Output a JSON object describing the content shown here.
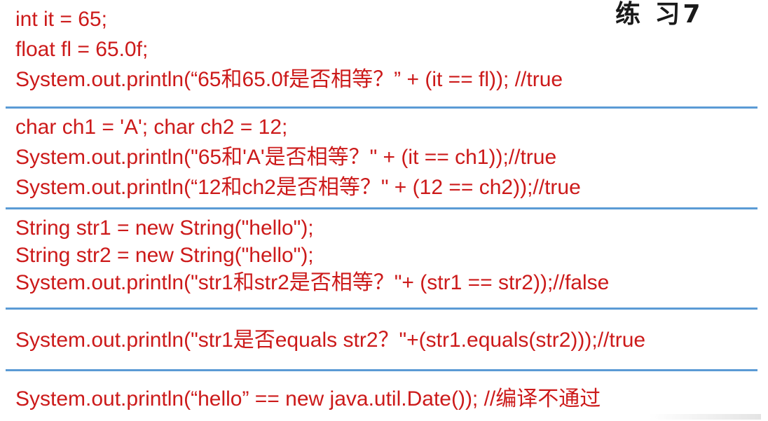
{
  "title": "练 习7",
  "sections": [
    {
      "lines": [
        "int it = 65;",
        "float fl = 65.0f;",
        "System.out.println(“65和65.0f是否相等？” + (it == fl)); //true"
      ]
    },
    {
      "lines": [
        "char ch1 = 'A'; char ch2 = 12;",
        "System.out.println(\"65和'A'是否相等？\" + (it == ch1));//true",
        "System.out.println(“12和ch2是否相等？\" + (12 == ch2));//true"
      ]
    },
    {
      "lines": [
        "String str1 = new String(\"hello\");",
        "String str2 = new String(\"hello\");",
        "System.out.println(\"str1和str2是否相等？\"+ (str1 == str2));//false"
      ]
    },
    {
      "lines": [
        "System.out.println(\"str1是否equals str2？\"+(str1.equals(str2)));//true"
      ]
    },
    {
      "lines": [
        "System.out.println(“hello” == new java.util.Date()); //编译不通过"
      ]
    }
  ],
  "colors": {
    "code_text": "#cc1a1a",
    "title_text": "#1a1a1a",
    "divider": "#5b9bd5",
    "background": "#ffffff"
  }
}
